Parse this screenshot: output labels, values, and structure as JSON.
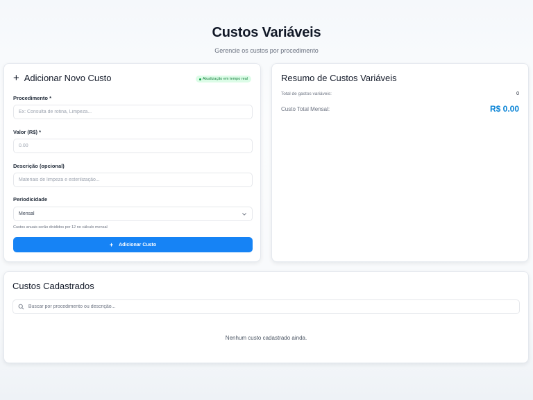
{
  "header": {
    "title": "Custos Variáveis",
    "subtitle": "Gerencie os custos por procedimento"
  },
  "add_form": {
    "title": "Adicionar Novo Custo",
    "plus_icon": "plus-icon",
    "badge": "Atualização em tempo real",
    "fields": {
      "procedimento": {
        "label": "Procedimento *",
        "placeholder": "Ex: Consulta de rotina, Limpeza..."
      },
      "valor": {
        "label": "Valor (R$) *",
        "placeholder": "0.00"
      },
      "descricao": {
        "label": "Descrição (opcional)",
        "placeholder": "Materiais de limpeza e esterilização..."
      },
      "periodicidade": {
        "label": "Periodicidade",
        "value": "Mensal",
        "icon": "chevron-down-icon"
      }
    },
    "helper": "Custos anuais serão divididos por 12 no cálculo mensal",
    "button": {
      "label": "Adicionar Custo",
      "icon": "+"
    }
  },
  "summary": {
    "title": "Resumo de Custos Variáveis",
    "count_label": "Total de gastos variáveis:",
    "count_value": "0",
    "total_label": "Custo Total Mensal:",
    "total_value": "R$ 0.00"
  },
  "list": {
    "title": "Custos Cadastrados",
    "search_placeholder": "Buscar por procedimento ou descrição...",
    "search_icon": "search-icon",
    "empty": "Nenhum custo cadastrado ainda."
  },
  "colors": {
    "accent": "#1683f5",
    "total": "#0b84d6",
    "badge_bg": "#dcfce7",
    "badge_text": "#15803d"
  }
}
